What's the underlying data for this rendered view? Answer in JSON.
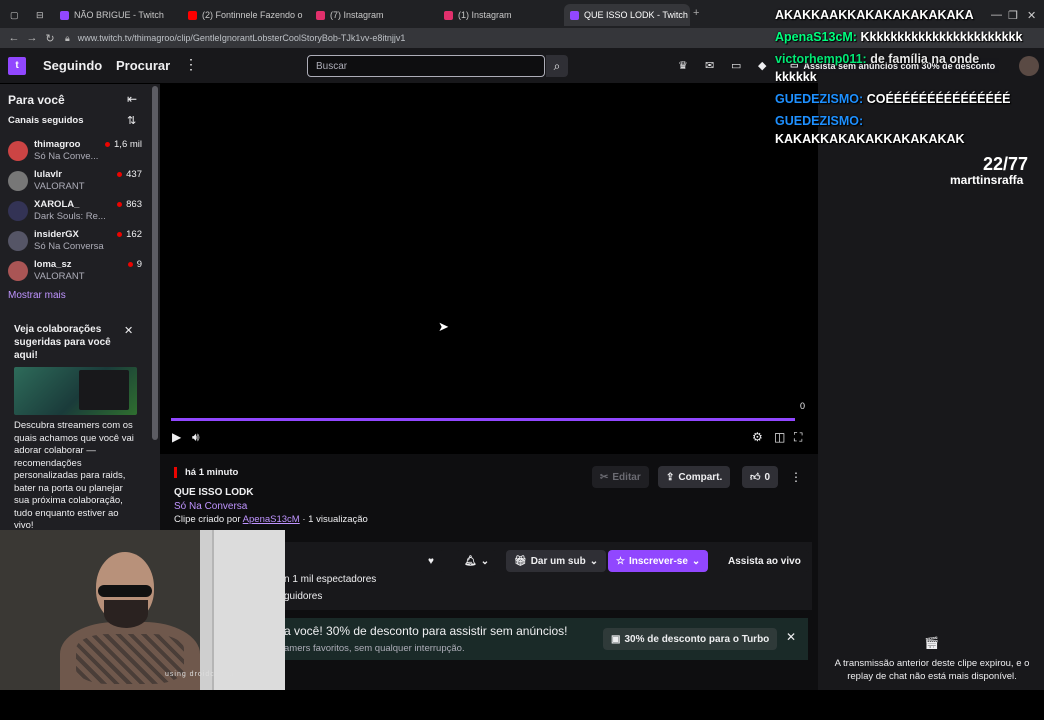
{
  "browser": {
    "tabs": [
      {
        "title": "NÃO BRIGUE - Twitch",
        "favcolor": "#9147ff"
      },
      {
        "title": "(2) Fontinnele Fazendo o",
        "favcolor": "#ff0000"
      },
      {
        "title": "(7) Instagram",
        "favcolor": "#e1306c"
      },
      {
        "title": "(1) Instagram",
        "favcolor": "#e1306c"
      },
      {
        "title": "QUE ISSO LODK - Twitch",
        "favcolor": "#9147ff"
      }
    ],
    "url": "www.twitch.tv/thimagroo/clip/GentleIgnorantLobsterCoolStoryBob-TJk1vv-e8itnjjv1"
  },
  "topbar": {
    "following": "Seguindo",
    "browse": "Procurar",
    "search_placeholder": "Buscar"
  },
  "sidebar": {
    "title": "Para você",
    "followed_title": "Canais seguidos",
    "channels": [
      {
        "name": "thimagroo",
        "game": "Só Na Conve...",
        "viewers": "1,6 mil",
        "color": "#c44"
      },
      {
        "name": "lulavlr",
        "game": "VALORANT",
        "viewers": "437",
        "color": "#777"
      },
      {
        "name": "XAROLA_",
        "game": "Dark Souls: Re...",
        "viewers": "863",
        "color": "#335"
      },
      {
        "name": "insiderGX",
        "game": "Só Na Conversa",
        "viewers": "162",
        "color": "#556"
      },
      {
        "name": "loma_sz",
        "game": "VALORANT",
        "viewers": "9",
        "color": "#a55"
      }
    ],
    "show_more": "Mostrar mais",
    "promo": {
      "title": "Veja colaborações sugeridas para você aqui!",
      "text": "Descubra streamers com os quais achamos que você vai adorar colaborar — recomendações personalizadas para raids, bater na porta ou planejar sua próxima colaboração, tudo enquanto estiver ao vivo!"
    }
  },
  "player": {
    "count": "0",
    "progress": 1.0
  },
  "clip": {
    "when": "há 1 minuto",
    "title": "QUE ISSO LODK",
    "game": "Só Na Conversa",
    "by_prefix": "Clipe criado por",
    "creator": "ApenaS13cM",
    "views": "· 1 visualização",
    "edit": "Editar",
    "share": "Compart.",
    "likes": "0"
  },
  "channel_bar": {
    "viewers": "n 1 mil espectadores",
    "followers": "guidores",
    "gift": "Dar um sub",
    "subscribe": "Inscrever-se",
    "watch_live": "Assista ao vivo"
  },
  "turbo": {
    "title": "a você! 30% de desconto para assistir sem anúncios!",
    "sub": "amers favoritos, sem qualquer interrupção.",
    "button": "30% de desconto para o Turbo"
  },
  "chat": {
    "ended": "A transmissão anterior deste clipe expirou, e o replay de chat não está mais disponível."
  },
  "overlay": {
    "lines": [
      {
        "name": "",
        "msg": "AKAKKAAKKAKAKAKAKAKAKA",
        "ncolor": "#ffffff"
      },
      {
        "name": "ApenaS13cM:",
        "msg": "Kkkkkkkkkkkkkkkkkkkkkkk",
        "ncolor": "#00ff7f"
      },
      {
        "name": "victorhemp011:",
        "msg": "de família na onde",
        "ncolor": "#00ff7f"
      },
      {
        "name": "",
        "msg": "kkkkkk",
        "ncolor": "#ffffff"
      },
      {
        "name": "GUEDEZISMO:",
        "msg": "COÉÉÉÉÉÉÉÉÉÉÉÉÉÉÉ",
        "ncolor": "#1e90ff"
      },
      {
        "name": "GUEDEZISMO:",
        "msg": "",
        "ncolor": "#1e90ff"
      },
      {
        "name": "",
        "msg": "KAKAKKAKAKAKKAKAKAKAK",
        "ncolor": "#ffffff"
      }
    ],
    "ad_text": "Assista sem anúncios com 30% de desconto",
    "counter": "22/77",
    "counter_name": "marttinsraffa",
    "cam_label": "using droidcam app"
  }
}
